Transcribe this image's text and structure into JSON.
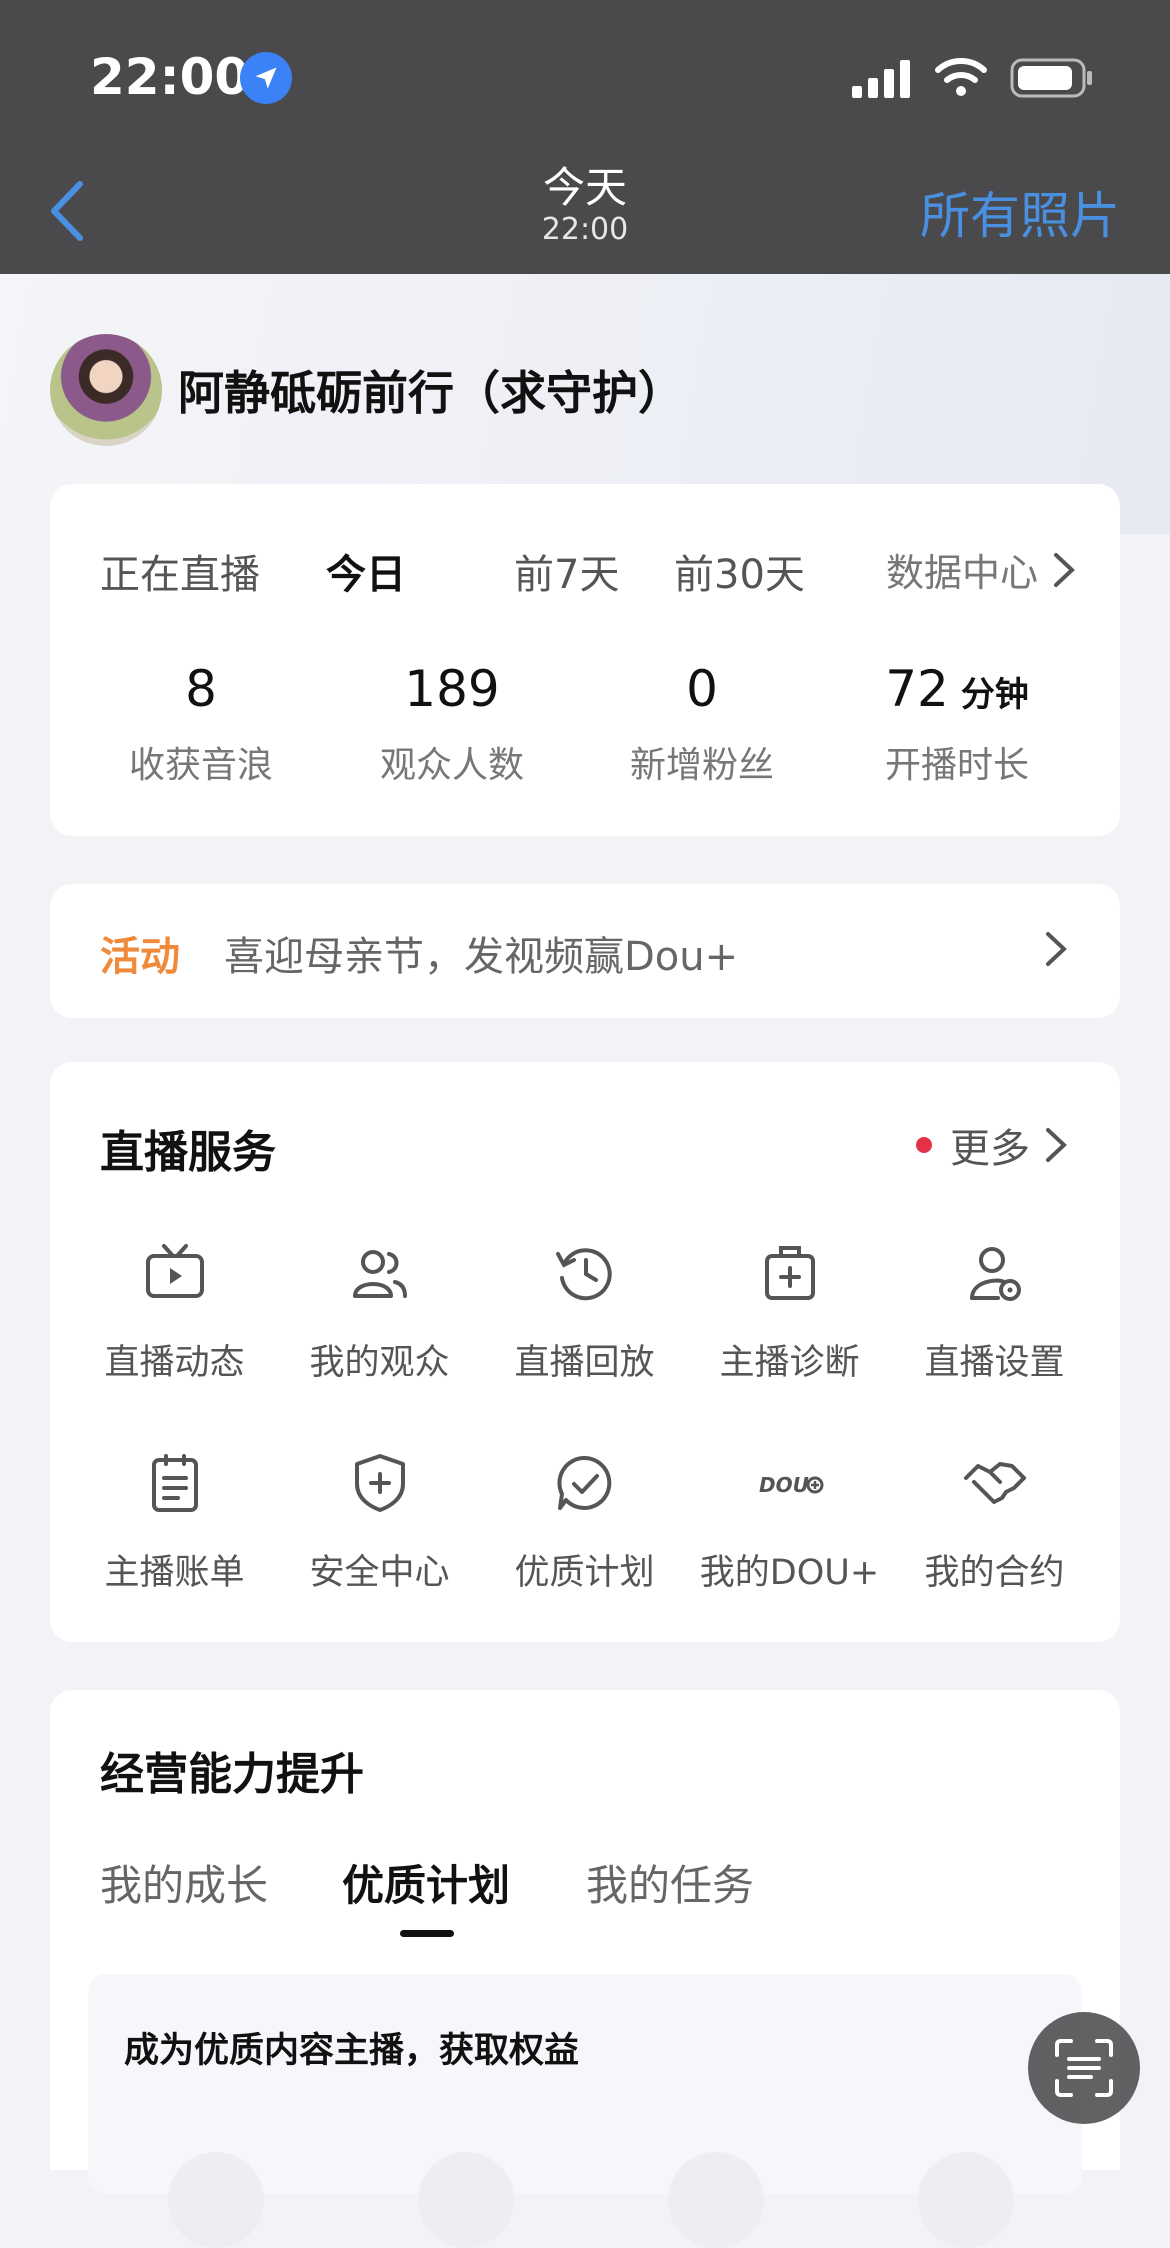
{
  "status_bar": {
    "time": "22:00"
  },
  "nav": {
    "title": "今天",
    "subtitle": "22:00",
    "right_label": "所有照片"
  },
  "profile": {
    "name": "阿静砥砺前行（求守护）"
  },
  "stats": {
    "tabs": [
      {
        "label": "正在直播",
        "active": false
      },
      {
        "label": "今日",
        "active": true
      },
      {
        "label": "前7天",
        "active": false
      },
      {
        "label": "前30天",
        "active": false
      }
    ],
    "data_center_label": "数据中心",
    "items": [
      {
        "value": "8",
        "unit": "",
        "label": "收获音浪"
      },
      {
        "value": "189",
        "unit": "",
        "label": "观众人数"
      },
      {
        "value": "0",
        "unit": "",
        "label": "新增粉丝"
      },
      {
        "value": "72",
        "unit": "分钟",
        "label": "开播时长"
      }
    ]
  },
  "activity": {
    "tag": "活动",
    "text": "喜迎母亲节，发视频赢Dou+"
  },
  "services": {
    "title": "直播服务",
    "more_label": "更多",
    "items": [
      {
        "label": "直播动态",
        "icon": "tv-icon"
      },
      {
        "label": "我的观众",
        "icon": "users-icon"
      },
      {
        "label": "直播回放",
        "icon": "history-icon"
      },
      {
        "label": "主播诊断",
        "icon": "medical-kit-icon"
      },
      {
        "label": "直播设置",
        "icon": "user-settings-icon"
      },
      {
        "label": "主播账单",
        "icon": "clipboard-icon"
      },
      {
        "label": "安全中心",
        "icon": "shield-plus-icon"
      },
      {
        "label": "优质计划",
        "icon": "check-chat-icon"
      },
      {
        "label": "我的DOU+",
        "icon": "dou-plus-icon"
      },
      {
        "label": "我的合约",
        "icon": "handshake-icon"
      }
    ]
  },
  "growth": {
    "title": "经营能力提升",
    "tabs": [
      {
        "label": "我的成长",
        "active": false
      },
      {
        "label": "优质计划",
        "active": true
      },
      {
        "label": "我的任务",
        "active": false
      }
    ],
    "banner_text": "成为优质内容主播，获取权益"
  },
  "colors": {
    "accent_blue": "#4a90e2",
    "activity_orange": "#f0893a",
    "dot_red": "#e5304a"
  }
}
